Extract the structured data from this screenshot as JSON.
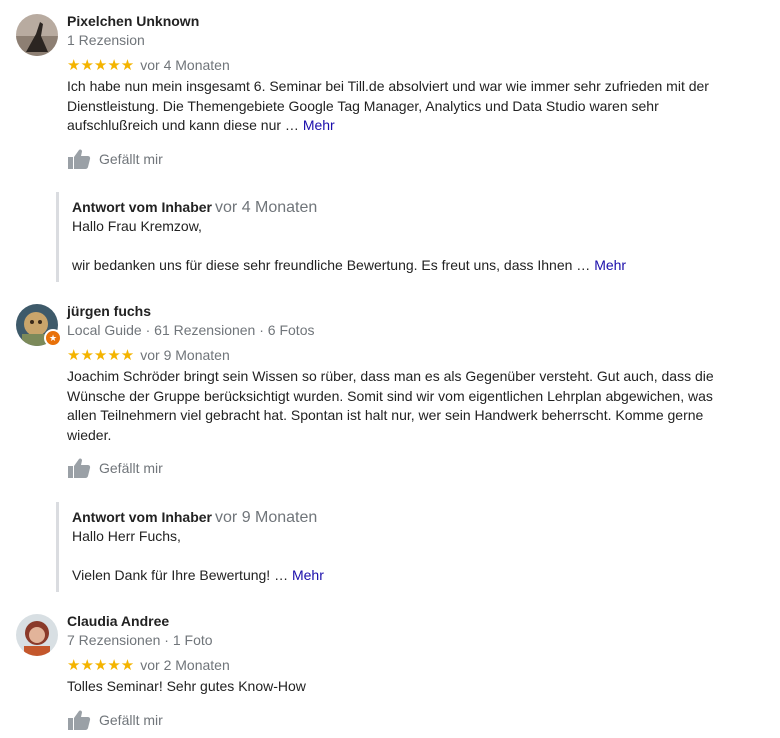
{
  "colors": {
    "star": "#f4b400",
    "link": "#1a0dab",
    "meta": "#70757a",
    "reply_bar": "#dadce0"
  },
  "reviews": [
    {
      "author": "Pixelchen Unknown",
      "meta": "1 Rezension",
      "stars": "★★★★★",
      "time": "vor 4 Monaten",
      "text": "Ich habe nun mein insgesamt 6. Seminar bei Till.de absolviert und war wie immer sehr zufrieden mit der Dienstleistung. Die Themengebiete Google Tag Manager, Analytics und Data Studio waren sehr aufschlußreich und kann diese nur …",
      "more": "Mehr",
      "like": "Gefällt mir",
      "reply": {
        "label": "Antwort vom Inhaber",
        "time": "vor 4 Monaten",
        "line1": "Hallo Frau Kremzow,",
        "line2": "wir bedanken uns für diese sehr freundliche Bewertung. Es freut uns, dass Ihnen …",
        "more": "Mehr"
      }
    },
    {
      "author": "jürgen fuchs",
      "meta": "Local Guide · 61 Rezensionen · 6 Fotos",
      "stars": "★★★★★",
      "time": "vor 9 Monaten",
      "text": "Joachim Schröder bringt sein Wissen so rüber, dass man es als Gegenüber versteht. Gut auch, dass die Wünsche der Gruppe berücksichtigt wurden. Somit sind wir vom eigentlichen Lehrplan abgewichen, was allen Teilnehmern viel gebracht hat. Spontan ist halt nur, wer sein Handwerk beherrscht. Komme gerne wieder.",
      "like": "Gefällt mir",
      "reply": {
        "label": "Antwort vom Inhaber",
        "time": "vor 9 Monaten",
        "line1": "Hallo Herr Fuchs,",
        "line2": "Vielen Dank für Ihre Bewertung! …",
        "more": "Mehr"
      }
    },
    {
      "author": "Claudia Andree",
      "meta": "7 Rezensionen · 1 Foto",
      "stars": "★★★★★",
      "time": "vor 2 Monaten",
      "text": "Tolles Seminar! Sehr gutes Know-How",
      "like": "Gefällt mir"
    }
  ]
}
